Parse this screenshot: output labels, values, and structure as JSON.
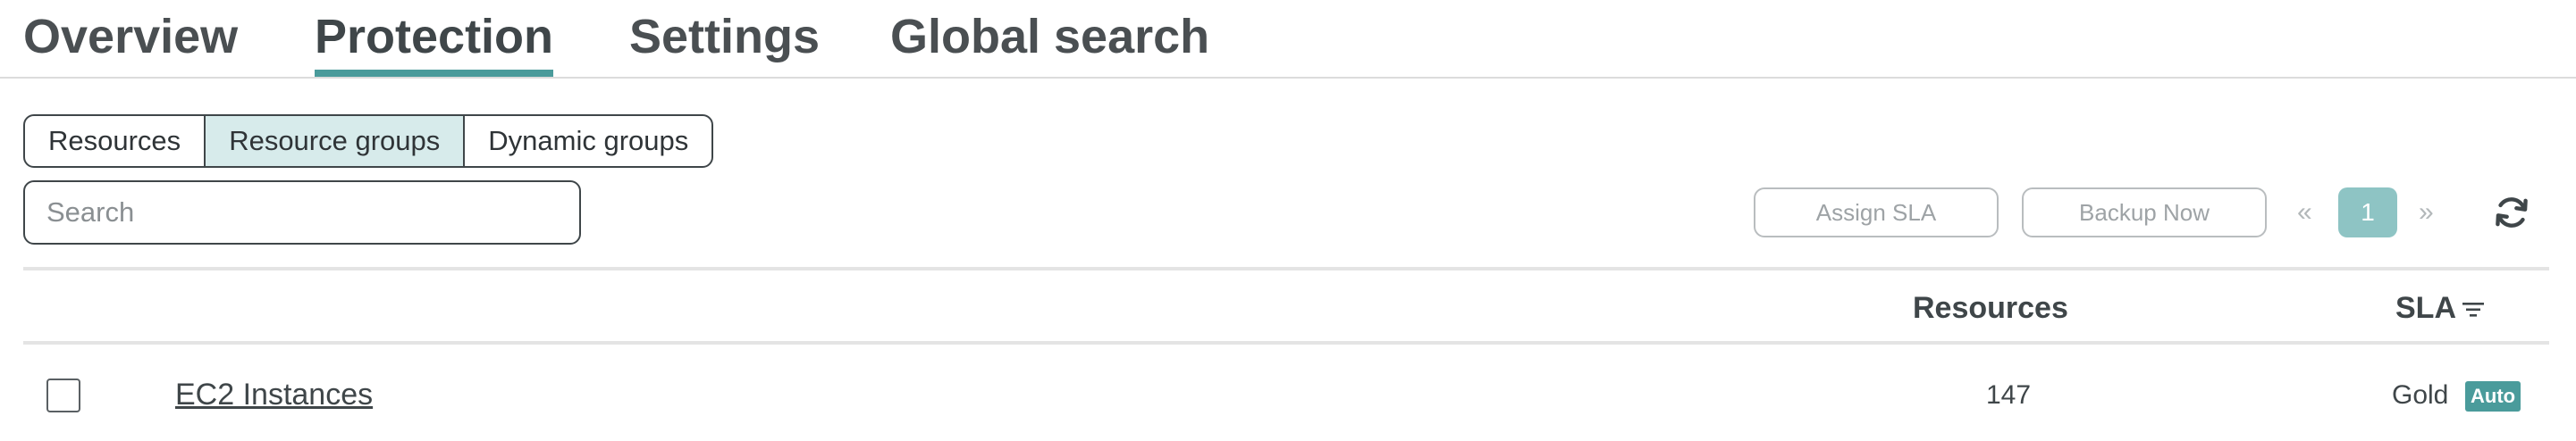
{
  "nav": {
    "tabs": [
      {
        "label": "Overview"
      },
      {
        "label": "Protection"
      },
      {
        "label": "Settings"
      },
      {
        "label": "Global search"
      }
    ],
    "active_tab": "Protection"
  },
  "segmented": {
    "options": [
      {
        "label": "Resources"
      },
      {
        "label": "Resource groups"
      },
      {
        "label": "Dynamic groups"
      }
    ],
    "selected": "Resource groups"
  },
  "search": {
    "placeholder": "Search",
    "value": ""
  },
  "toolbar": {
    "assign_sla_label": "Assign SLA",
    "backup_now_label": "Backup Now",
    "pager_prev": "«",
    "pager_current": "1",
    "pager_next": "»",
    "refresh_icon": "refresh-icon"
  },
  "table": {
    "columns": [
      {
        "label": "Resources"
      },
      {
        "label": "SLA"
      }
    ],
    "rows": [
      {
        "name": "EC2 Instances",
        "resources": "147",
        "sla": "Gold",
        "badge": "Auto"
      }
    ]
  },
  "colors": {
    "accent": "#4a9b9b",
    "selected_segment_bg": "#d7ebeb",
    "pager_active_bg": "#8ec4c4",
    "text": "#3f4649",
    "disabled_text": "#9ea3a6"
  }
}
